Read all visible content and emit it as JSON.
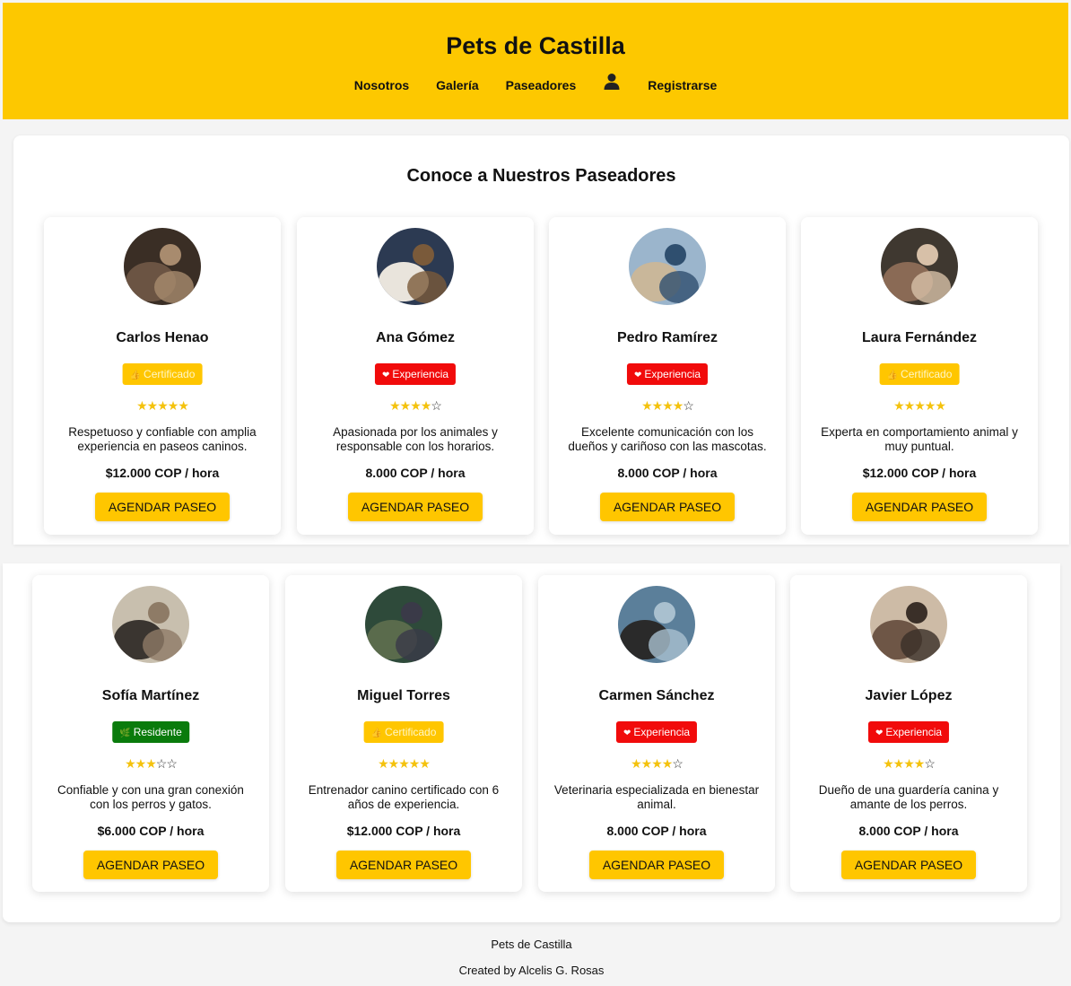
{
  "header": {
    "brand": "Pets de Castilla",
    "nav": {
      "nosotros": "Nosotros",
      "galeria": "Galería",
      "paseadores": "Paseadores",
      "registrarse": "Registrarse"
    }
  },
  "main": {
    "title": "Conoce a Nuestros Paseadores",
    "button_label": "AGENDAR PASEO",
    "walkers": [
      {
        "name": "Carlos Henao",
        "badge": "Certificado",
        "badge_type": "certified",
        "rating": 5,
        "description": "Respetuoso y confiable con amplia experiencia en paseos caninos.",
        "price": "$12.000 COP / hora"
      },
      {
        "name": "Ana Gómez",
        "badge": "Experiencia",
        "badge_type": "experience",
        "rating": 4,
        "description": "Apasionada por los animales y responsable con los horarios.",
        "price": "8.000 COP / hora"
      },
      {
        "name": "Pedro Ramírez",
        "badge": "Experiencia",
        "badge_type": "experience",
        "rating": 4,
        "description": "Excelente comunicación con los dueños y cariñoso con las mascotas.",
        "price": "8.000 COP / hora"
      },
      {
        "name": "Laura Fernández",
        "badge": "Certificado",
        "badge_type": "certified",
        "rating": 5,
        "description": "Experta en comportamiento animal y muy puntual.",
        "price": "$12.000 COP / hora"
      },
      {
        "name": "Sofía Martínez",
        "badge": "Residente",
        "badge_type": "resident",
        "rating": 3,
        "description": "Confiable y con una gran conexión con los perros y gatos.",
        "price": "$6.000 COP / hora"
      },
      {
        "name": "Miguel Torres",
        "badge": "Certificado",
        "badge_type": "certified",
        "rating": 5,
        "description": "Entrenador canino certificado con 6 años de experiencia.",
        "price": "$12.000 COP / hora"
      },
      {
        "name": "Carmen Sánchez",
        "badge": "Experiencia",
        "badge_type": "experience",
        "rating": 4,
        "description": "Veterinaria especializada en bienestar animal.",
        "price": "8.000 COP / hora"
      },
      {
        "name": "Javier López",
        "badge": "Experiencia",
        "badge_type": "experience",
        "rating": 4,
        "description": "Dueño de una guardería canina y amante de los perros.",
        "price": "8.000 COP / hora"
      }
    ]
  },
  "footer": {
    "line1": "Pets de Castilla",
    "line2": "Created by Alcelis G. Rosas"
  },
  "icons": {
    "user": "user-icon",
    "certified": "thumbs-up-icon",
    "experience": "heart-icon",
    "resident": "leaf-icon",
    "star": "star-icon"
  },
  "colors": {
    "accent": "#fdc800",
    "button": "#ffc600",
    "experience": "#f10b0b",
    "resident": "#0a7b0c",
    "star": "#f4c20d"
  }
}
